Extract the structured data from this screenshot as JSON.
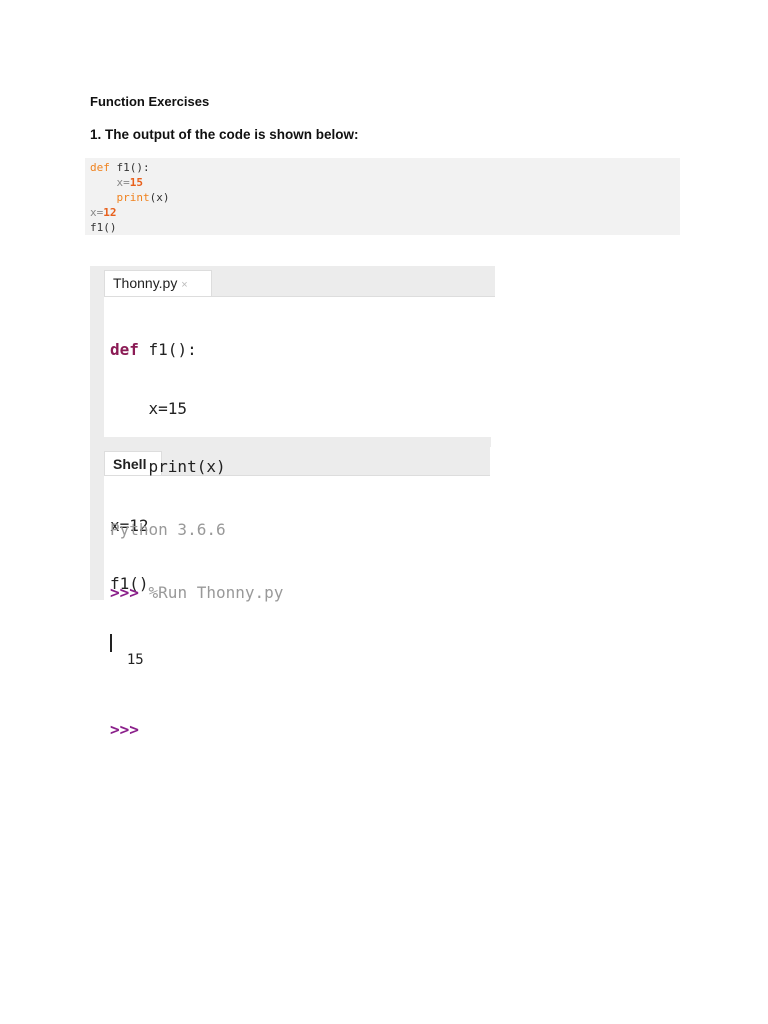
{
  "heading": "Function Exercises",
  "question": "1. The output of the code is shown below:",
  "code": {
    "l1_kw": "def",
    "l1_rest": " f1():",
    "l2_ind": "    ",
    "l2_var": "x",
    "l2_eq": "=",
    "l2_num": "15",
    "l3_ind": "    ",
    "l3_fn": "print",
    "l3_rest": "(x)",
    "l4_var": "x",
    "l4_eq": "=",
    "l4_num": "12",
    "l5": "f1()"
  },
  "editor": {
    "tab_label": "Thonny.py",
    "close_icon": "×",
    "lines": {
      "l1_kw": "def",
      "l1_rest": " f1():",
      "l2": "    x=15",
      "l3": "    print(x)",
      "l4": "x=12",
      "l5": "f1()"
    }
  },
  "shell": {
    "tab_label": "Shell",
    "version": "Python 3.6.6",
    "prompt": ">>>",
    "command": " %Run Thonny.py",
    "output": "  15",
    "prompt2": ">>>"
  }
}
